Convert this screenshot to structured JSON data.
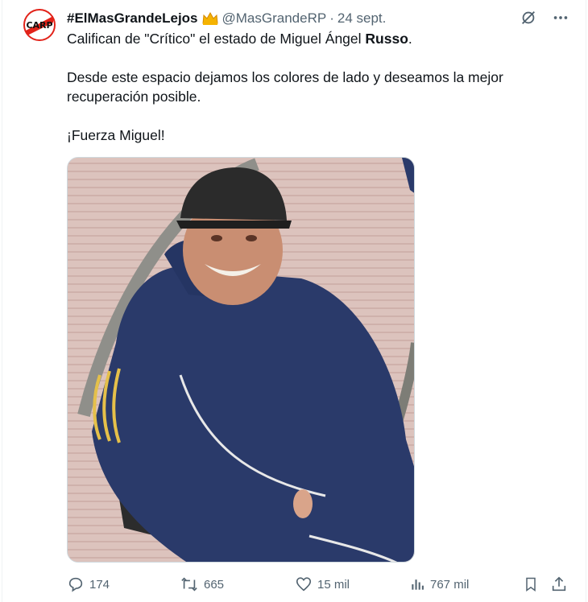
{
  "tweet": {
    "display_name": "#ElMasGrandeLejos",
    "handle": "@MasGrandeRP",
    "separator": "·",
    "date": "24 sept.",
    "avatar_icon": "river-plate-crest-icon",
    "badge_icon": "crown-icon",
    "text": {
      "line1_prefix": "Califican de \"Crítico\" el estado de Miguel Ángel ",
      "line1_bold": "Russo",
      "line1_suffix": ".",
      "paragraph2": "Desde este espacio dejamos los colores de lado y deseamos la mejor recuperación posible.",
      "paragraph3": "¡Fuerza Miguel!"
    },
    "media": {
      "type": "photo"
    }
  },
  "actions": {
    "replies": {
      "icon": "reply-icon",
      "count": "174"
    },
    "retweets": {
      "icon": "retweet-icon",
      "count": "665"
    },
    "likes": {
      "icon": "heart-icon",
      "count": "15 mil"
    },
    "views": {
      "icon": "views-chart-icon",
      "count": "767 mil"
    },
    "bookmark": {
      "icon": "bookmark-icon"
    },
    "share": {
      "icon": "share-icon"
    }
  },
  "top_icons": [
    "grok-icon",
    "more-icon"
  ],
  "colors": {
    "text": "#0f1419",
    "secondary": "#536471",
    "crest_red": "#e2231a"
  }
}
